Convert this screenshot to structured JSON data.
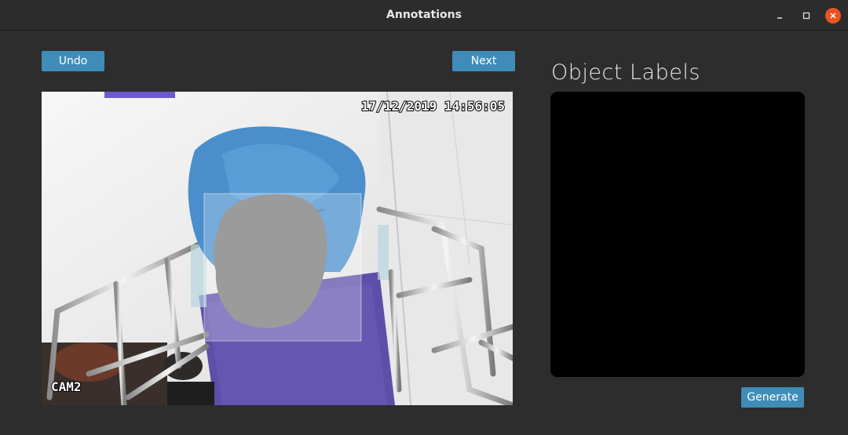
{
  "window": {
    "title": "Annotations",
    "controls": [
      "minimize-icon",
      "maximize-icon",
      "close-icon"
    ],
    "close_color": "#e95420"
  },
  "toolbar": {
    "undo_label": "Undo",
    "next_label": "Next",
    "button_color": "#3f8cb8"
  },
  "image": {
    "timestamp": "17/12/2019 14:56:05",
    "camera_label": "CAM2",
    "content": "overhead-cctv-frame"
  },
  "labels_panel": {
    "title": "Object Labels",
    "items": [],
    "generate_label": "Generate"
  }
}
